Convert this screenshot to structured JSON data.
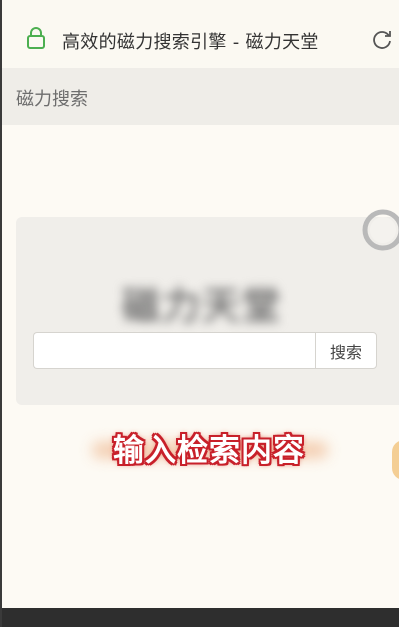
{
  "browser": {
    "page_title": "高效的磁力搜索引擎 - 磁力天堂",
    "lock_icon": "lock-icon",
    "reload_icon": "reload-icon"
  },
  "site": {
    "header_title": "磁力搜索",
    "brand_logo": "磁力天堂"
  },
  "search": {
    "input_value": "",
    "button_label": "搜索"
  },
  "overlay": {
    "caption": "输入检索内容"
  },
  "colors": {
    "accent_green": "#4caf50",
    "caption_stroke": "#c8202a",
    "page_background": "#fdfaf4"
  }
}
